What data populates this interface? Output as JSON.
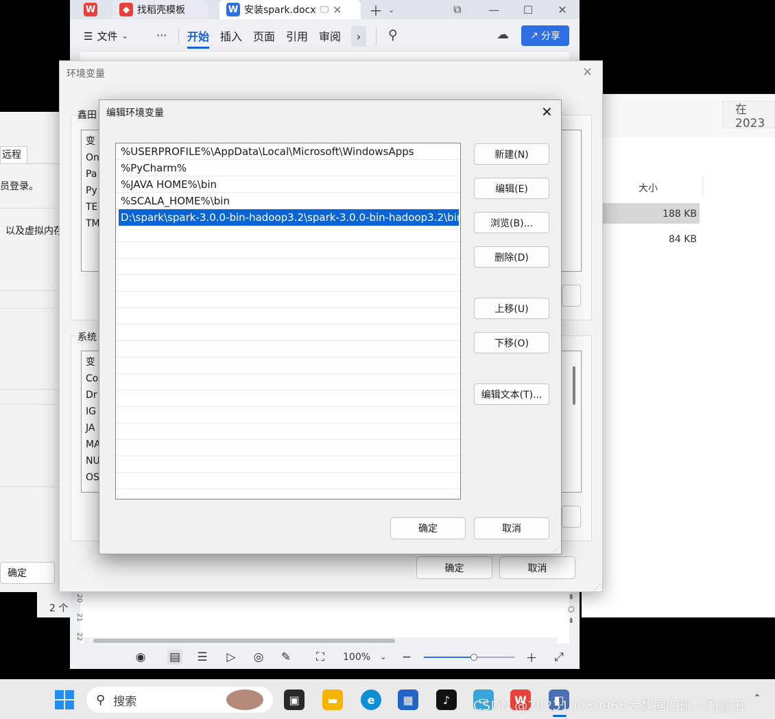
{
  "wps": {
    "tabs": [
      {
        "label": ""
      },
      {
        "label": "找稻壳模板"
      },
      {
        "label": "安装spark.docx"
      }
    ],
    "menu": {
      "file": "文件",
      "more": "···",
      "items": [
        "开始",
        "插入",
        "页面",
        "引用",
        "审阅"
      ],
      "share": "分享"
    },
    "status": {
      "zoom": "100%",
      "zoom_level": 0.55,
      "ruler": [
        "20",
        "21",
        "22"
      ]
    }
  },
  "explorer": {
    "search_text": "在 2023",
    "column_header": "大小",
    "rows": [
      {
        "size": "188 KB"
      },
      {
        "size": "84 KB"
      }
    ]
  },
  "left_window": {
    "texts": [
      "远程",
      "员登录。",
      "以及虚拟内存",
      "确定",
      "2 个"
    ]
  },
  "env_dialog": {
    "title": "环境变量",
    "user_group_label": "鑫田",
    "user_vars": [
      "变",
      "On",
      "Pa",
      "Py",
      "TE",
      "TM"
    ],
    "system_group_label": "系统",
    "system_vars": [
      "变",
      "Co",
      "Dr",
      "IG",
      "JA",
      "MA",
      "NU",
      "OS"
    ],
    "ok": "确定",
    "cancel": "取消"
  },
  "edit_dialog": {
    "title": "编辑环境变量",
    "paths": [
      "%USERPROFILE%\\AppData\\Local\\Microsoft\\WindowsApps",
      "%PyCharm%",
      "%JAVA HOME%\\bin",
      "%SCALA_HOME%\\bin",
      "D:\\spark\\spark-3.0.0-bin-hadoop3.2\\spark-3.0.0-bin-hadoop3.2\\bin"
    ],
    "selected_index": 4,
    "buttons": {
      "new": "新建(N)",
      "edit": "编辑(E)",
      "browse": "浏览(B)...",
      "delete": "删除(D)",
      "up": "上移(U)",
      "down": "下移(O)",
      "edit_text": "编辑文本(T)...",
      "ok": "确定",
      "cancel": "取消"
    }
  },
  "taskbar": {
    "search_placeholder": "搜索",
    "watermark": "CSDN @202310030966大数据四班—刘鑫田"
  },
  "colors": {
    "accent": "#0a64d6",
    "wps_blue": "#2f6fe4",
    "wps_red": "#e8413b"
  }
}
